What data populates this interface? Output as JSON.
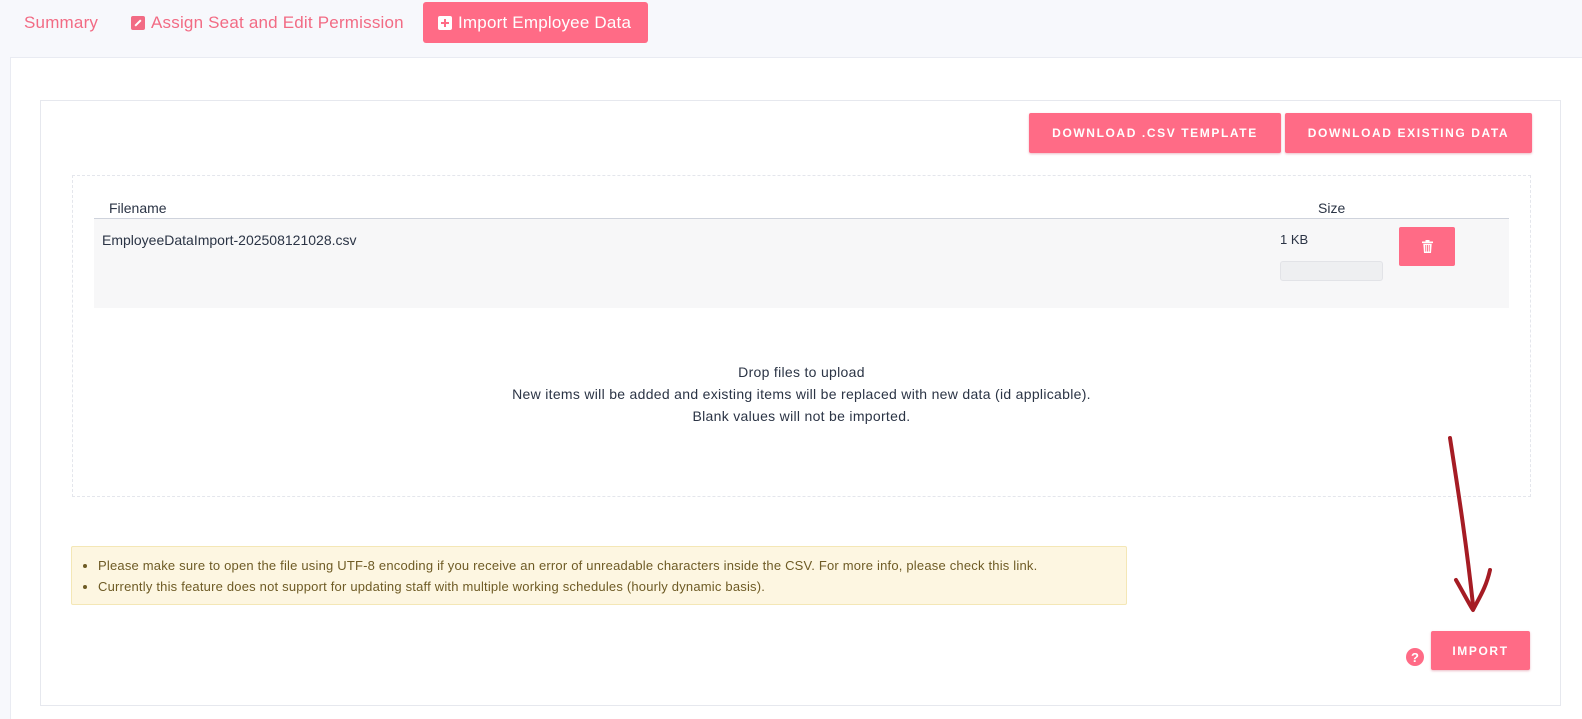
{
  "tabs": {
    "summary": "Summary",
    "assign": "Assign Seat and Edit Permission",
    "import": "Import Employee Data"
  },
  "actions": {
    "download_template": "DOWNLOAD .CSV TEMPLATE",
    "download_existing": "DOWNLOAD EXISTING DATA",
    "import": "IMPORT"
  },
  "table": {
    "headers": {
      "filename": "Filename",
      "size": "Size"
    },
    "rows": [
      {
        "filename": "EmployeeDataImport-202508121028.csv",
        "size": "1 KB"
      }
    ]
  },
  "dropzone": {
    "line1": "Drop files to upload",
    "line2": "New items will be added and existing items will be replaced with new data (id applicable).",
    "line3": "Blank values will not be imported."
  },
  "notices": [
    "Please make sure to open the file using UTF-8 encoding if you receive an error of unreadable characters inside the CSV. For more info, please check this link.",
    "Currently this feature does not support for updating staff with multiple working schedules (hourly dynamic basis)."
  ],
  "icons": {
    "assign_tab": "edit-icon",
    "import_tab": "plus-square-icon",
    "delete": "trash-icon",
    "help": "question-icon",
    "annotation": "red-arrow"
  },
  "colors": {
    "accent": "#ff6b86",
    "notice_bg": "#fdf6e1",
    "annotation_arrow": "#a51c24"
  }
}
